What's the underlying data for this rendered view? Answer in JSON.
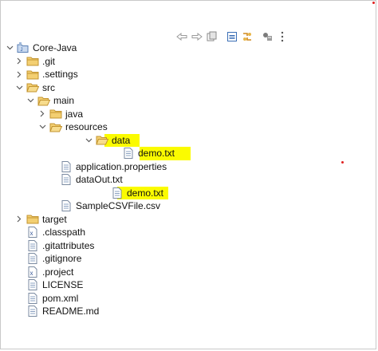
{
  "toolbar": {
    "buttons": [
      "back-icon",
      "forward-icon",
      "collapse-all-icon",
      "link-editor-icon",
      "sync-icon",
      "filter-icon",
      "view-menu-icon"
    ]
  },
  "tree": {
    "items": [
      {
        "label": "Core-Java"
      },
      {
        "label": ".git"
      },
      {
        "label": ".settings"
      },
      {
        "label": "src"
      },
      {
        "label": "main"
      },
      {
        "label": "java"
      },
      {
        "label": "resources"
      },
      {
        "label": "data"
      },
      {
        "label": "demo.txt"
      },
      {
        "label": "application.properties"
      },
      {
        "label": "dataOut.txt"
      },
      {
        "label": "demo.txt"
      },
      {
        "label": "SampleCSVFile.csv"
      },
      {
        "label": "target"
      },
      {
        "label": ".classpath"
      },
      {
        "label": ".gitattributes"
      },
      {
        "label": ".gitignore"
      },
      {
        "label": ".project"
      },
      {
        "label": "LICENSE"
      },
      {
        "label": "pom.xml"
      },
      {
        "label": "README.md"
      }
    ]
  },
  "colors": {
    "highlight": "#fbfb00",
    "folder": "#e8b64a",
    "twisty": "#5a5a5a",
    "annotation_dot": "#e02020"
  }
}
